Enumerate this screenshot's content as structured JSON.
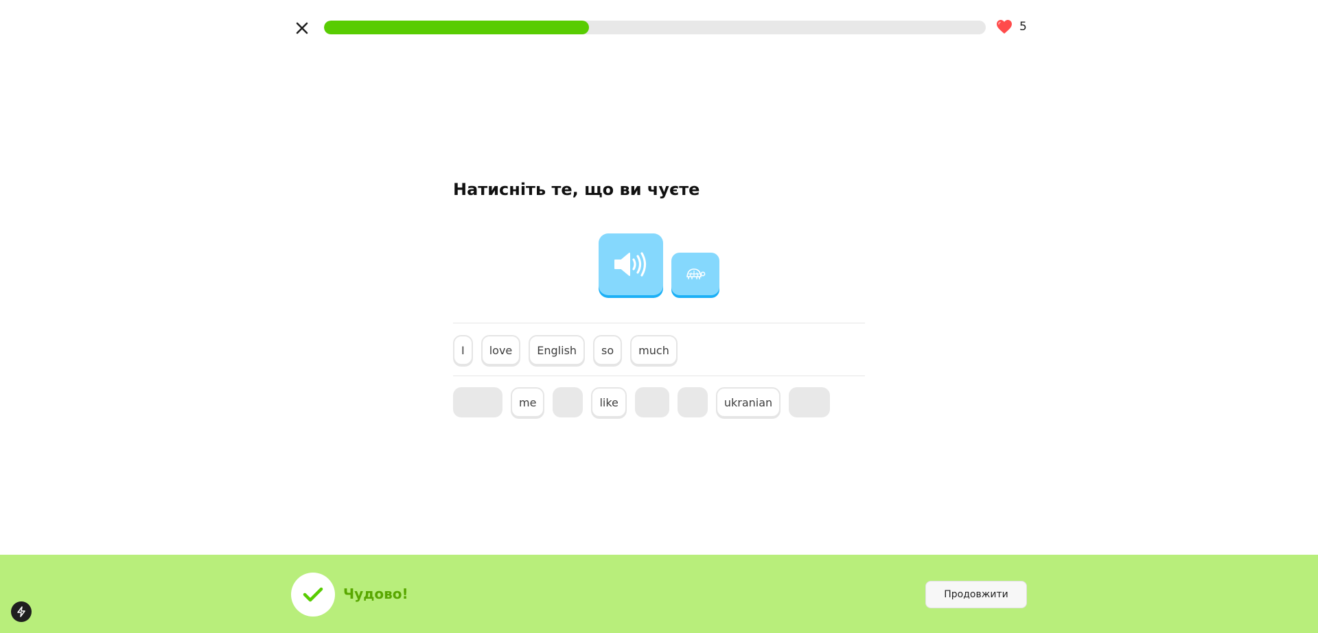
{
  "progress": {
    "value_percent": 40,
    "color": "#58cc02"
  },
  "hearts": {
    "count": "5",
    "color": "#ff4b4b"
  },
  "icons": {
    "close": "close-icon",
    "heart": "heart-icon",
    "speaker": "speaker-icon",
    "turtle": "turtle-icon",
    "check": "checkmark-icon",
    "bolt": "bolt-icon"
  },
  "prompt": {
    "title": "Натисніть те, що ви чуєте"
  },
  "answer": {
    "words": [
      "I",
      "love",
      "English",
      "so",
      "much"
    ]
  },
  "word_bank": {
    "tiles": [
      {
        "text": "",
        "used": true
      },
      {
        "text": "me",
        "used": false
      },
      {
        "text": "",
        "used": true
      },
      {
        "text": "like",
        "used": false
      },
      {
        "text": "",
        "used": true
      },
      {
        "text": "",
        "used": true
      },
      {
        "text": "ukranian",
        "used": false
      },
      {
        "text": "",
        "used": true
      }
    ]
  },
  "feedback": {
    "message": "Чудово!",
    "continue_label": "Продовжити",
    "background_color": "#b8ee7b",
    "text_color": "#58a700"
  }
}
